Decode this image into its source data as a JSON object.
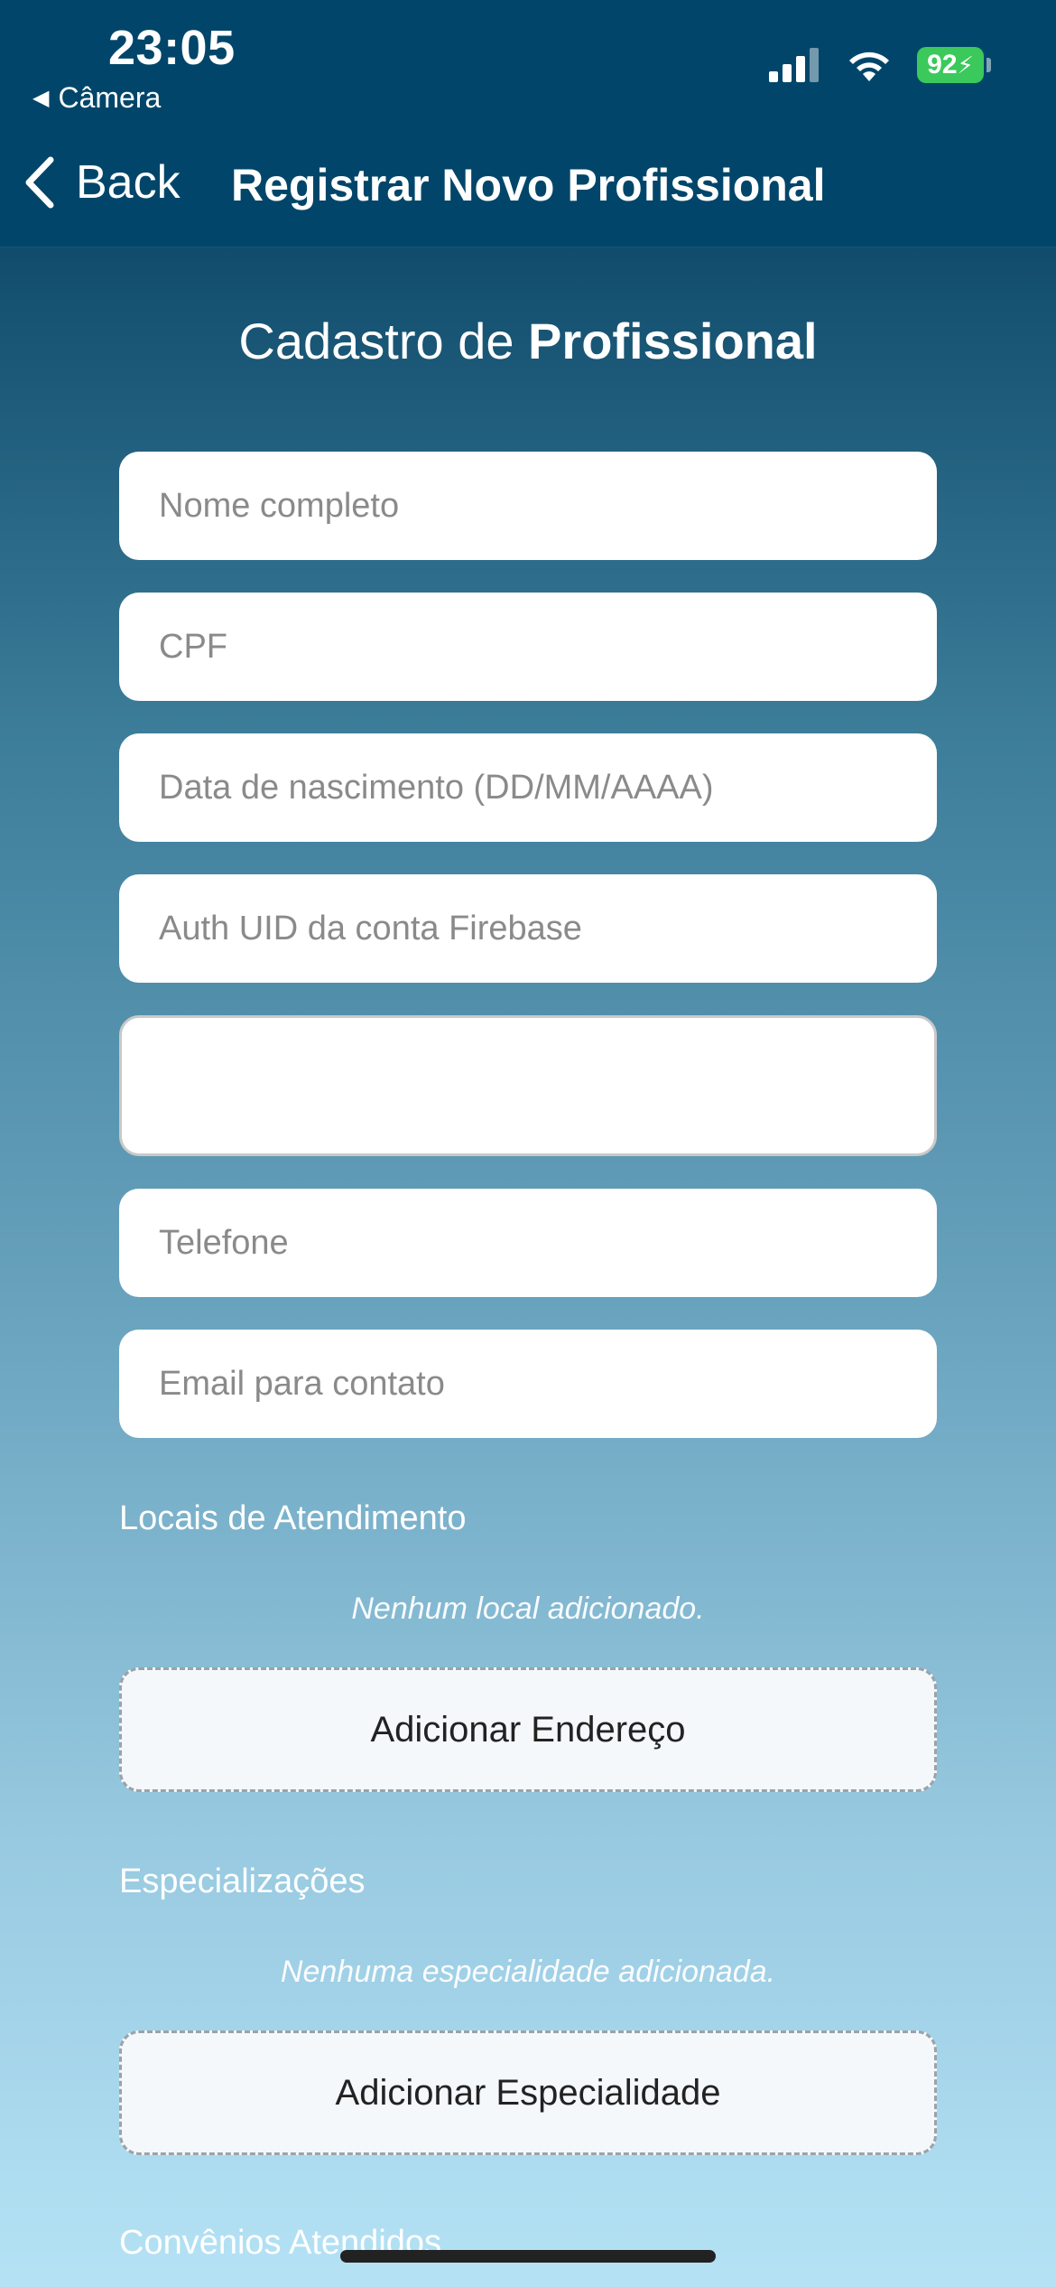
{
  "status_bar": {
    "time": "23:05",
    "back_app": "Câmera",
    "battery": "92"
  },
  "nav": {
    "back_label": "Back",
    "title": "Registrar Novo Profissional"
  },
  "form": {
    "heading_normal": "Cadastro de ",
    "heading_bold": "Profissional",
    "fields": {
      "nome": "Nome completo",
      "cpf": "CPF",
      "nascimento": "Data de nascimento (DD/MM/AAAA)",
      "auth_uid": "Auth UID da conta Firebase",
      "telefone": "Telefone",
      "email": "Email para contato"
    }
  },
  "locais": {
    "label": "Locais de Atendimento",
    "empty": "Nenhum local adicionado.",
    "button": "Adicionar Endereço"
  },
  "especializacoes": {
    "label": "Especializações",
    "empty": "Nenhuma especialidade adicionada.",
    "button": "Adicionar Especialidade"
  },
  "convenios": {
    "label": "Convênios Atendidos"
  }
}
